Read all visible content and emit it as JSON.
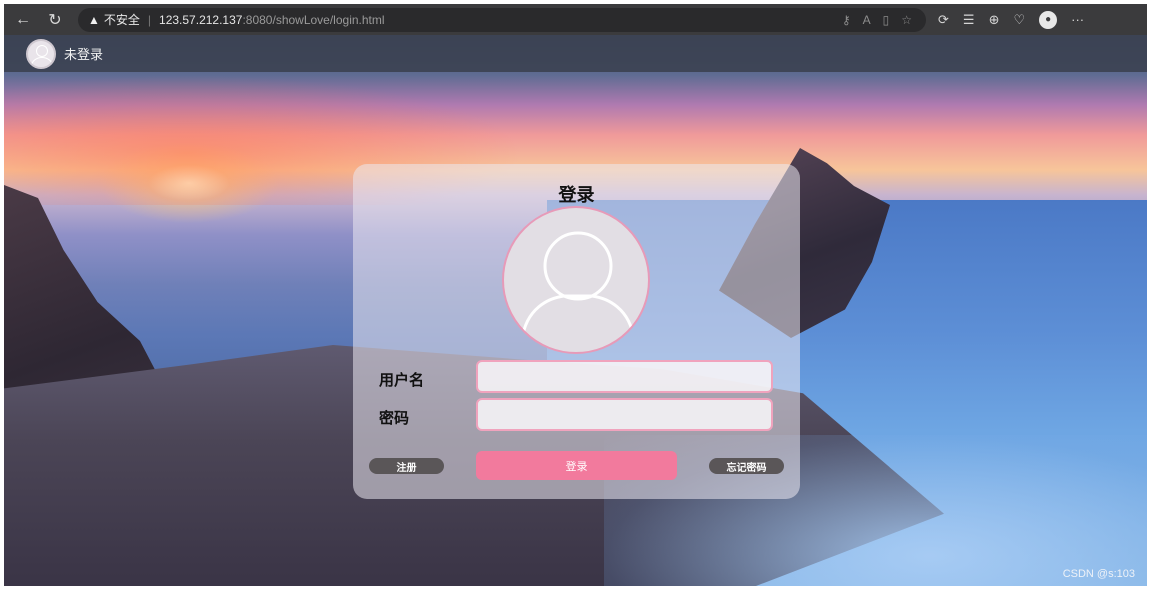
{
  "browser": {
    "back_icon": "←",
    "refresh_icon": "↻",
    "security_icon": "▲",
    "security_label": "不安全",
    "separator": "|",
    "url_host": "123.57.212.137",
    "url_path": ":8080/showLove/login.html",
    "address_icons": [
      "key-icon",
      "read-aloud-icon",
      "reader-view-icon",
      "star-icon"
    ],
    "toolbar_icons": [
      "extensions-icon",
      "favorites-icon",
      "collections-icon",
      "health-icon",
      "profile-icon",
      "more-icon"
    ]
  },
  "userbar": {
    "status": "未登录"
  },
  "login": {
    "title": "登录",
    "username_label": "用户名",
    "username_value": "",
    "password_label": "密码",
    "password_value": "",
    "register_label": "注册",
    "login_label": "登录",
    "forgot_label": "忘记密码"
  },
  "watermark": "CSDN @s:103",
  "colors": {
    "accent_pink": "#f27a9d",
    "button_dark": "#5a5658",
    "chrome_bg": "#3b3b3d"
  }
}
